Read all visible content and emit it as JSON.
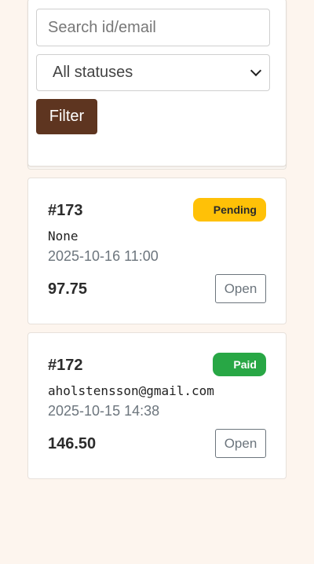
{
  "filters": {
    "search_placeholder": "Search id/email",
    "status_selected": "All statuses",
    "filter_label": "Filter"
  },
  "orders": [
    {
      "id": "#173",
      "status": "Pending",
      "email": "None",
      "date": "2025-10-16 11:00",
      "amount": "97.75",
      "open_label": "Open"
    },
    {
      "id": "#172",
      "status": "Paid",
      "email": "aholstensson@gmail.com",
      "date": "2025-10-15 14:38",
      "amount": "146.50",
      "open_label": "Open"
    }
  ],
  "colors": {
    "background": "#fdf5ee",
    "filter_button": "#5e3520",
    "pending": "#ffc107",
    "paid": "#28a745"
  }
}
